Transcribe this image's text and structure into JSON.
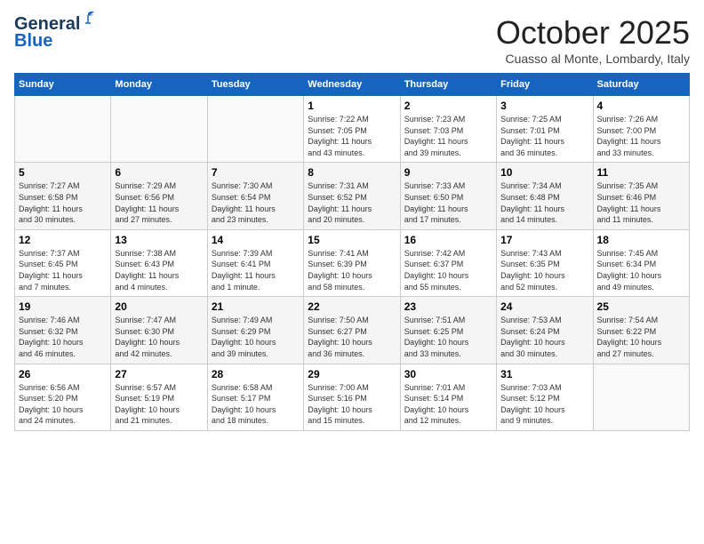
{
  "header": {
    "logo_general": "General",
    "logo_blue": "Blue",
    "month": "October 2025",
    "location": "Cuasso al Monte, Lombardy, Italy"
  },
  "weekdays": [
    "Sunday",
    "Monday",
    "Tuesday",
    "Wednesday",
    "Thursday",
    "Friday",
    "Saturday"
  ],
  "weeks": [
    [
      {
        "day": "",
        "info": ""
      },
      {
        "day": "",
        "info": ""
      },
      {
        "day": "",
        "info": ""
      },
      {
        "day": "1",
        "info": "Sunrise: 7:22 AM\nSunset: 7:05 PM\nDaylight: 11 hours\nand 43 minutes."
      },
      {
        "day": "2",
        "info": "Sunrise: 7:23 AM\nSunset: 7:03 PM\nDaylight: 11 hours\nand 39 minutes."
      },
      {
        "day": "3",
        "info": "Sunrise: 7:25 AM\nSunset: 7:01 PM\nDaylight: 11 hours\nand 36 minutes."
      },
      {
        "day": "4",
        "info": "Sunrise: 7:26 AM\nSunset: 7:00 PM\nDaylight: 11 hours\nand 33 minutes."
      }
    ],
    [
      {
        "day": "5",
        "info": "Sunrise: 7:27 AM\nSunset: 6:58 PM\nDaylight: 11 hours\nand 30 minutes."
      },
      {
        "day": "6",
        "info": "Sunrise: 7:29 AM\nSunset: 6:56 PM\nDaylight: 11 hours\nand 27 minutes."
      },
      {
        "day": "7",
        "info": "Sunrise: 7:30 AM\nSunset: 6:54 PM\nDaylight: 11 hours\nand 23 minutes."
      },
      {
        "day": "8",
        "info": "Sunrise: 7:31 AM\nSunset: 6:52 PM\nDaylight: 11 hours\nand 20 minutes."
      },
      {
        "day": "9",
        "info": "Sunrise: 7:33 AM\nSunset: 6:50 PM\nDaylight: 11 hours\nand 17 minutes."
      },
      {
        "day": "10",
        "info": "Sunrise: 7:34 AM\nSunset: 6:48 PM\nDaylight: 11 hours\nand 14 minutes."
      },
      {
        "day": "11",
        "info": "Sunrise: 7:35 AM\nSunset: 6:46 PM\nDaylight: 11 hours\nand 11 minutes."
      }
    ],
    [
      {
        "day": "12",
        "info": "Sunrise: 7:37 AM\nSunset: 6:45 PM\nDaylight: 11 hours\nand 7 minutes."
      },
      {
        "day": "13",
        "info": "Sunrise: 7:38 AM\nSunset: 6:43 PM\nDaylight: 11 hours\nand 4 minutes."
      },
      {
        "day": "14",
        "info": "Sunrise: 7:39 AM\nSunset: 6:41 PM\nDaylight: 11 hours\nand 1 minute."
      },
      {
        "day": "15",
        "info": "Sunrise: 7:41 AM\nSunset: 6:39 PM\nDaylight: 10 hours\nand 58 minutes."
      },
      {
        "day": "16",
        "info": "Sunrise: 7:42 AM\nSunset: 6:37 PM\nDaylight: 10 hours\nand 55 minutes."
      },
      {
        "day": "17",
        "info": "Sunrise: 7:43 AM\nSunset: 6:35 PM\nDaylight: 10 hours\nand 52 minutes."
      },
      {
        "day": "18",
        "info": "Sunrise: 7:45 AM\nSunset: 6:34 PM\nDaylight: 10 hours\nand 49 minutes."
      }
    ],
    [
      {
        "day": "19",
        "info": "Sunrise: 7:46 AM\nSunset: 6:32 PM\nDaylight: 10 hours\nand 46 minutes."
      },
      {
        "day": "20",
        "info": "Sunrise: 7:47 AM\nSunset: 6:30 PM\nDaylight: 10 hours\nand 42 minutes."
      },
      {
        "day": "21",
        "info": "Sunrise: 7:49 AM\nSunset: 6:29 PM\nDaylight: 10 hours\nand 39 minutes."
      },
      {
        "day": "22",
        "info": "Sunrise: 7:50 AM\nSunset: 6:27 PM\nDaylight: 10 hours\nand 36 minutes."
      },
      {
        "day": "23",
        "info": "Sunrise: 7:51 AM\nSunset: 6:25 PM\nDaylight: 10 hours\nand 33 minutes."
      },
      {
        "day": "24",
        "info": "Sunrise: 7:53 AM\nSunset: 6:24 PM\nDaylight: 10 hours\nand 30 minutes."
      },
      {
        "day": "25",
        "info": "Sunrise: 7:54 AM\nSunset: 6:22 PM\nDaylight: 10 hours\nand 27 minutes."
      }
    ],
    [
      {
        "day": "26",
        "info": "Sunrise: 6:56 AM\nSunset: 5:20 PM\nDaylight: 10 hours\nand 24 minutes."
      },
      {
        "day": "27",
        "info": "Sunrise: 6:57 AM\nSunset: 5:19 PM\nDaylight: 10 hours\nand 21 minutes."
      },
      {
        "day": "28",
        "info": "Sunrise: 6:58 AM\nSunset: 5:17 PM\nDaylight: 10 hours\nand 18 minutes."
      },
      {
        "day": "29",
        "info": "Sunrise: 7:00 AM\nSunset: 5:16 PM\nDaylight: 10 hours\nand 15 minutes."
      },
      {
        "day": "30",
        "info": "Sunrise: 7:01 AM\nSunset: 5:14 PM\nDaylight: 10 hours\nand 12 minutes."
      },
      {
        "day": "31",
        "info": "Sunrise: 7:03 AM\nSunset: 5:12 PM\nDaylight: 10 hours\nand 9 minutes."
      },
      {
        "day": "",
        "info": ""
      }
    ]
  ]
}
